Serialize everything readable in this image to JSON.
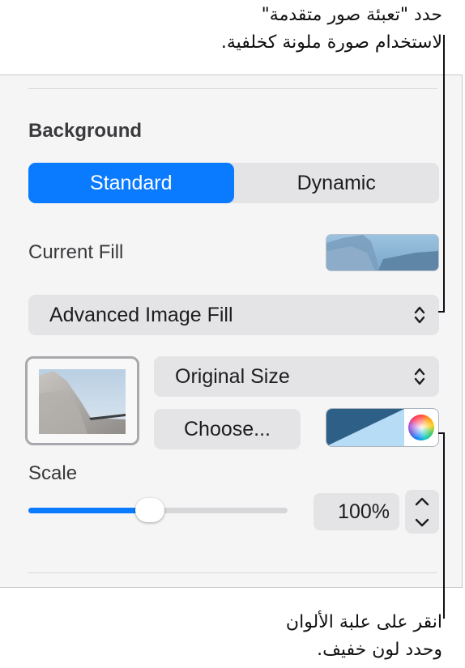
{
  "callouts": {
    "top": [
      "حدد \"تعبئة صور متقدمة\"",
      "لاستخدام صورة ملونة كخلفية."
    ],
    "bottom": [
      "انقر على علبة الألوان",
      "وحدد لون خفيف."
    ]
  },
  "background": {
    "title": "Background",
    "segments": [
      {
        "label": "Standard",
        "selected": true
      },
      {
        "label": "Dynamic",
        "selected": false
      }
    ],
    "current_fill_label": "Current Fill",
    "fill_type": "Advanced Image Fill",
    "image_scaling": "Original Size",
    "choose_label": "Choose...",
    "tint_colors": [
      "#2e5f86",
      "#b6dcf6"
    ],
    "scale_label": "Scale",
    "scale_value": "100%",
    "scale_fraction": 0.47
  },
  "colors": {
    "accent": "#0a7aff"
  }
}
